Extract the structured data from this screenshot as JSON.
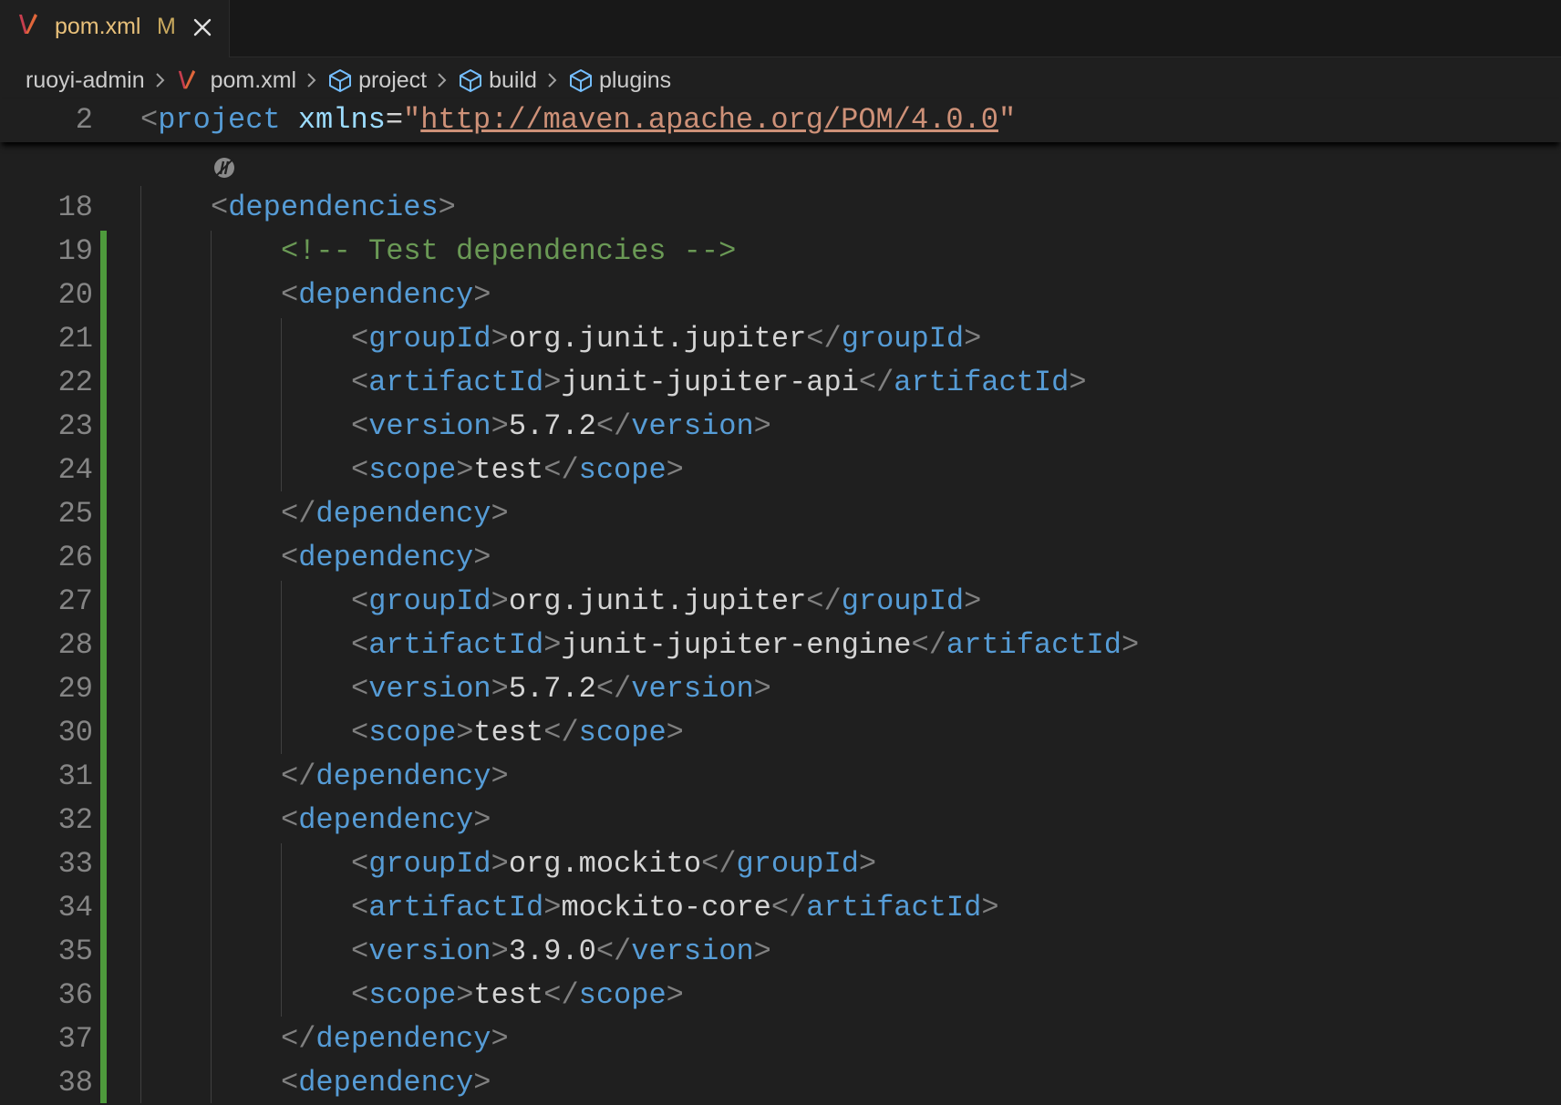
{
  "tab": {
    "filename": "pom.xml",
    "modified_badge": "M"
  },
  "breadcrumb": [
    "ruoyi-admin",
    "pom.xml",
    "project",
    "build",
    "plugins"
  ],
  "sticky_line": {
    "number": "2",
    "open": "<",
    "tag": "project",
    "attr": "xmlns",
    "eq": "=",
    "quote_open": "\"",
    "value": "http://maven.apache.org/POM/4.0.0",
    "quote_close": "\""
  },
  "lines": [
    {
      "n": "18",
      "indent": 1,
      "parts": [
        [
          "punct",
          "<"
        ],
        [
          "tag",
          "dependencies"
        ],
        [
          "punct",
          ">"
        ]
      ]
    },
    {
      "n": "19",
      "indent": 2,
      "parts": [
        [
          "cmt",
          "<!-- Test dependencies -->"
        ]
      ]
    },
    {
      "n": "20",
      "indent": 2,
      "parts": [
        [
          "punct",
          "<"
        ],
        [
          "tag",
          "dependency"
        ],
        [
          "punct",
          ">"
        ]
      ]
    },
    {
      "n": "21",
      "indent": 3,
      "parts": [
        [
          "punct",
          "<"
        ],
        [
          "tag",
          "groupId"
        ],
        [
          "punct",
          ">"
        ],
        [
          "txt",
          "org.junit.jupiter"
        ],
        [
          "punct",
          "</"
        ],
        [
          "tag",
          "groupId"
        ],
        [
          "punct",
          ">"
        ]
      ]
    },
    {
      "n": "22",
      "indent": 3,
      "parts": [
        [
          "punct",
          "<"
        ],
        [
          "tag",
          "artifactId"
        ],
        [
          "punct",
          ">"
        ],
        [
          "txt",
          "junit-jupiter-api"
        ],
        [
          "punct",
          "</"
        ],
        [
          "tag",
          "artifactId"
        ],
        [
          "punct",
          ">"
        ]
      ]
    },
    {
      "n": "23",
      "indent": 3,
      "parts": [
        [
          "punct",
          "<"
        ],
        [
          "tag",
          "version"
        ],
        [
          "punct",
          ">"
        ],
        [
          "txt",
          "5.7.2"
        ],
        [
          "punct",
          "</"
        ],
        [
          "tag",
          "version"
        ],
        [
          "punct",
          ">"
        ]
      ]
    },
    {
      "n": "24",
      "indent": 3,
      "parts": [
        [
          "punct",
          "<"
        ],
        [
          "tag",
          "scope"
        ],
        [
          "punct",
          ">"
        ],
        [
          "txt",
          "test"
        ],
        [
          "punct",
          "</"
        ],
        [
          "tag",
          "scope"
        ],
        [
          "punct",
          ">"
        ]
      ]
    },
    {
      "n": "25",
      "indent": 2,
      "parts": [
        [
          "punct",
          "</"
        ],
        [
          "tag",
          "dependency"
        ],
        [
          "punct",
          ">"
        ]
      ]
    },
    {
      "n": "26",
      "indent": 2,
      "parts": [
        [
          "punct",
          "<"
        ],
        [
          "tag",
          "dependency"
        ],
        [
          "punct",
          ">"
        ]
      ]
    },
    {
      "n": "27",
      "indent": 3,
      "parts": [
        [
          "punct",
          "<"
        ],
        [
          "tag",
          "groupId"
        ],
        [
          "punct",
          ">"
        ],
        [
          "txt",
          "org.junit.jupiter"
        ],
        [
          "punct",
          "</"
        ],
        [
          "tag",
          "groupId"
        ],
        [
          "punct",
          ">"
        ]
      ]
    },
    {
      "n": "28",
      "indent": 3,
      "parts": [
        [
          "punct",
          "<"
        ],
        [
          "tag",
          "artifactId"
        ],
        [
          "punct",
          ">"
        ],
        [
          "txt",
          "junit-jupiter-engine"
        ],
        [
          "punct",
          "</"
        ],
        [
          "tag",
          "artifactId"
        ],
        [
          "punct",
          ">"
        ]
      ]
    },
    {
      "n": "29",
      "indent": 3,
      "parts": [
        [
          "punct",
          "<"
        ],
        [
          "tag",
          "version"
        ],
        [
          "punct",
          ">"
        ],
        [
          "txt",
          "5.7.2"
        ],
        [
          "punct",
          "</"
        ],
        [
          "tag",
          "version"
        ],
        [
          "punct",
          ">"
        ]
      ]
    },
    {
      "n": "30",
      "indent": 3,
      "parts": [
        [
          "punct",
          "<"
        ],
        [
          "tag",
          "scope"
        ],
        [
          "punct",
          ">"
        ],
        [
          "txt",
          "test"
        ],
        [
          "punct",
          "</"
        ],
        [
          "tag",
          "scope"
        ],
        [
          "punct",
          ">"
        ]
      ]
    },
    {
      "n": "31",
      "indent": 2,
      "parts": [
        [
          "punct",
          "</"
        ],
        [
          "tag",
          "dependency"
        ],
        [
          "punct",
          ">"
        ]
      ]
    },
    {
      "n": "32",
      "indent": 2,
      "parts": [
        [
          "punct",
          "<"
        ],
        [
          "tag",
          "dependency"
        ],
        [
          "punct",
          ">"
        ]
      ]
    },
    {
      "n": "33",
      "indent": 3,
      "parts": [
        [
          "punct",
          "<"
        ],
        [
          "tag",
          "groupId"
        ],
        [
          "punct",
          ">"
        ],
        [
          "txt",
          "org.mockito"
        ],
        [
          "punct",
          "</"
        ],
        [
          "tag",
          "groupId"
        ],
        [
          "punct",
          ">"
        ]
      ]
    },
    {
      "n": "34",
      "indent": 3,
      "parts": [
        [
          "punct",
          "<"
        ],
        [
          "tag",
          "artifactId"
        ],
        [
          "punct",
          ">"
        ],
        [
          "txt",
          "mockito-core"
        ],
        [
          "punct",
          "</"
        ],
        [
          "tag",
          "artifactId"
        ],
        [
          "punct",
          ">"
        ]
      ]
    },
    {
      "n": "35",
      "indent": 3,
      "parts": [
        [
          "punct",
          "<"
        ],
        [
          "tag",
          "version"
        ],
        [
          "punct",
          ">"
        ],
        [
          "txt",
          "3.9.0"
        ],
        [
          "punct",
          "</"
        ],
        [
          "tag",
          "version"
        ],
        [
          "punct",
          ">"
        ]
      ]
    },
    {
      "n": "36",
      "indent": 3,
      "parts": [
        [
          "punct",
          "<"
        ],
        [
          "tag",
          "scope"
        ],
        [
          "punct",
          ">"
        ],
        [
          "txt",
          "test"
        ],
        [
          "punct",
          "</"
        ],
        [
          "tag",
          "scope"
        ],
        [
          "punct",
          ">"
        ]
      ]
    },
    {
      "n": "37",
      "indent": 2,
      "parts": [
        [
          "punct",
          "</"
        ],
        [
          "tag",
          "dependency"
        ],
        [
          "punct",
          ">"
        ]
      ]
    },
    {
      "n": "38",
      "indent": 2,
      "parts": [
        [
          "punct",
          "<"
        ],
        [
          "tag",
          "dependency"
        ],
        [
          "punct",
          ">"
        ]
      ]
    }
  ],
  "icons": {
    "file": "maven-icon",
    "close": "close-icon",
    "symbol": "cube-icon",
    "separator": "chevron-right-icon",
    "codelens": "codelens-icon"
  },
  "colors": {
    "background": "#1f1f1f",
    "tag": "#569cd6",
    "attribute": "#9cdcfe",
    "string": "#ce9178",
    "comment": "#6a9955",
    "modified_gutter": "#4e9a3c"
  }
}
